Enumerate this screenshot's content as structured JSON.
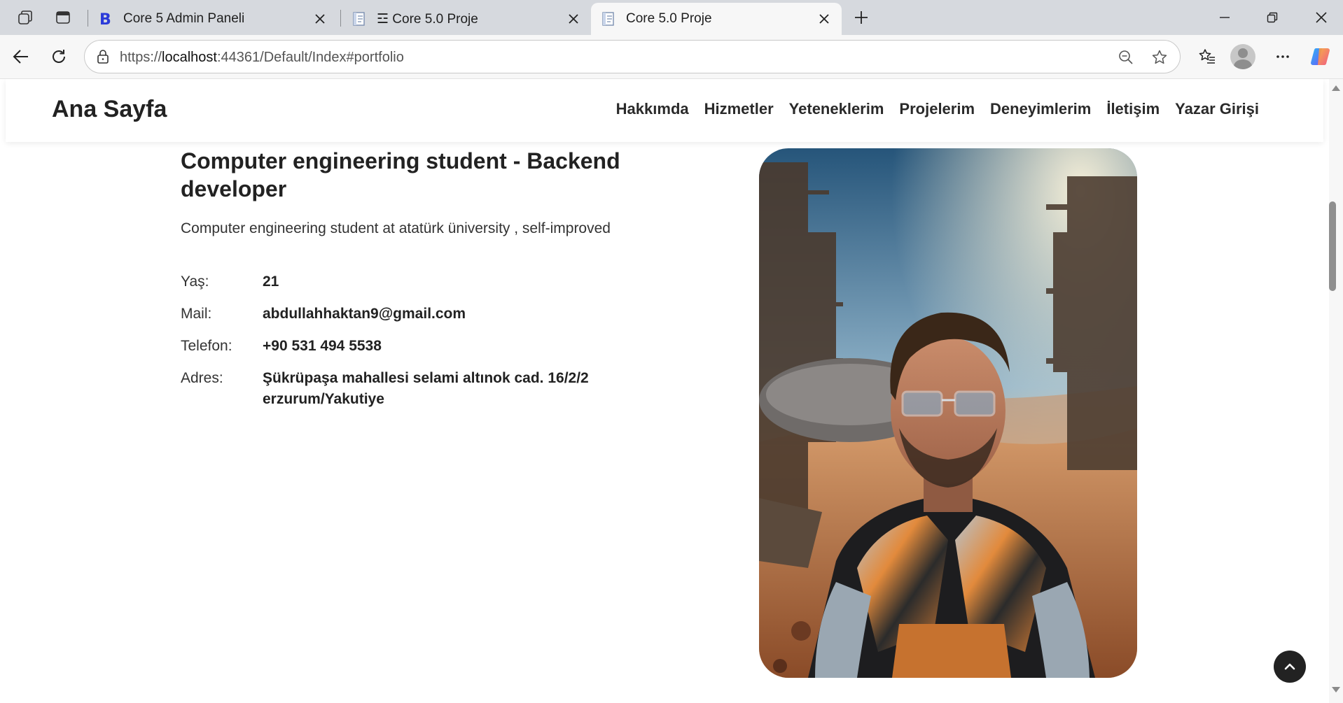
{
  "browser": {
    "tabs": [
      {
        "label": "Core 5 Admin Paneli",
        "favicon": "bootstrap-b-icon"
      },
      {
        "label": "☲ Core 5.0 Proje",
        "favicon": "document-icon"
      },
      {
        "label": "Core 5.0 Proje",
        "favicon": "document-icon"
      }
    ],
    "url_prefix": "https://",
    "url_host": "localhost",
    "url_rest": ":44361/Default/Index#portfolio",
    "accent": "#0f6cbd"
  },
  "site": {
    "brand": "Ana Sayfa",
    "nav": [
      "Hakkımda",
      "Hizmetler",
      "Yeteneklerim",
      "Projelerim",
      "Deneyimlerim",
      "İletişim",
      "Yazar Girişi"
    ]
  },
  "about": {
    "title": "Computer engineering student - Backend developer",
    "description": "Computer engineering student at atatürk üniversity , self-improved",
    "info": [
      {
        "label": "Yaş:",
        "value": "21"
      },
      {
        "label": "Mail:",
        "value": "abdullahhaktan9@gmail.com"
      },
      {
        "label": "Telefon:",
        "value": "+90 531 494 5538"
      },
      {
        "label": "Adres:",
        "value": "Şükrüpaşa mahallesi selami altınok cad. 16/2/2 erzurum/Yakutiye"
      }
    ]
  }
}
